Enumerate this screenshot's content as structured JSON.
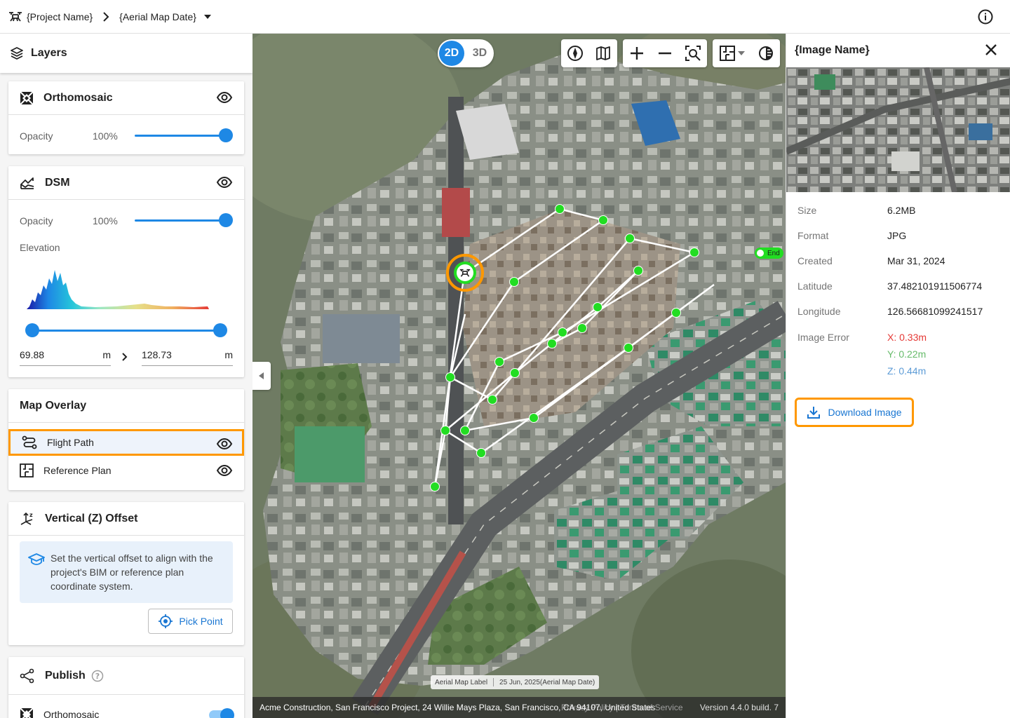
{
  "topbar": {
    "project": "{Project Name}",
    "map_date": "{Aerial Map Date}"
  },
  "layers": {
    "title": "Layers",
    "orthomosaic": {
      "title": "Orthomosaic",
      "opacity_label": "Opacity",
      "opacity_value": "100%",
      "opacity_fraction": 1.0
    },
    "dsm": {
      "title": "DSM",
      "opacity_label": "Opacity",
      "opacity_value": "100%",
      "opacity_fraction": 1.0,
      "elevation_label": "Elevation",
      "min_value": "69.88",
      "max_value": "128.73",
      "unit": "m"
    },
    "map_overlay": {
      "title": "Map Overlay",
      "items": [
        {
          "label": "Flight Path",
          "selected": true
        },
        {
          "label": "Reference Plan",
          "selected": false
        }
      ]
    },
    "vertical_offset": {
      "title": "Vertical (Z) Offset",
      "info": "Set the vertical offset to align with the project's BIM or reference plan coordinate system.",
      "pick_label": "Pick Point"
    },
    "publish": {
      "title": "Publish",
      "item": "Orthomosaic"
    }
  },
  "map": {
    "mode_2d": "2D",
    "mode_3d": "3D",
    "end_label": "End",
    "map_label": "Aerial Map Label",
    "map_label_date": "25 Jun, 2025(Aerial Map Date)",
    "address": "Acme Construction, San Francisco Project, 24 Willie Mays Plaza, San Francisco, CA 94107, United States",
    "terms": "Privacy Policy  |  Terms of Service",
    "version": "Version 4.4.0 build. 7"
  },
  "image_panel": {
    "title": "{Image Name}",
    "fields": [
      {
        "key": "Size",
        "value": "6.2MB"
      },
      {
        "key": "Format",
        "value": "JPG"
      },
      {
        "key": "Created",
        "value": "Mar 31, 2024"
      },
      {
        "key": "Latitude",
        "value": "37.482101911506774"
      },
      {
        "key": "Longitude",
        "value": "126.56681099241517"
      }
    ],
    "error_label": "Image Error",
    "error_x": "X: 0.33m",
    "error_y": "Y: 0.22m",
    "error_z": "Z: 0.44m",
    "download_label": "Download Image"
  },
  "colors": {
    "accent": "#1e88e5",
    "highlight": "#ff9800",
    "waypoint": "#22dd22",
    "error_x": "#e53935",
    "error_y": "#66bb6a",
    "error_z": "#5c9bd6"
  }
}
